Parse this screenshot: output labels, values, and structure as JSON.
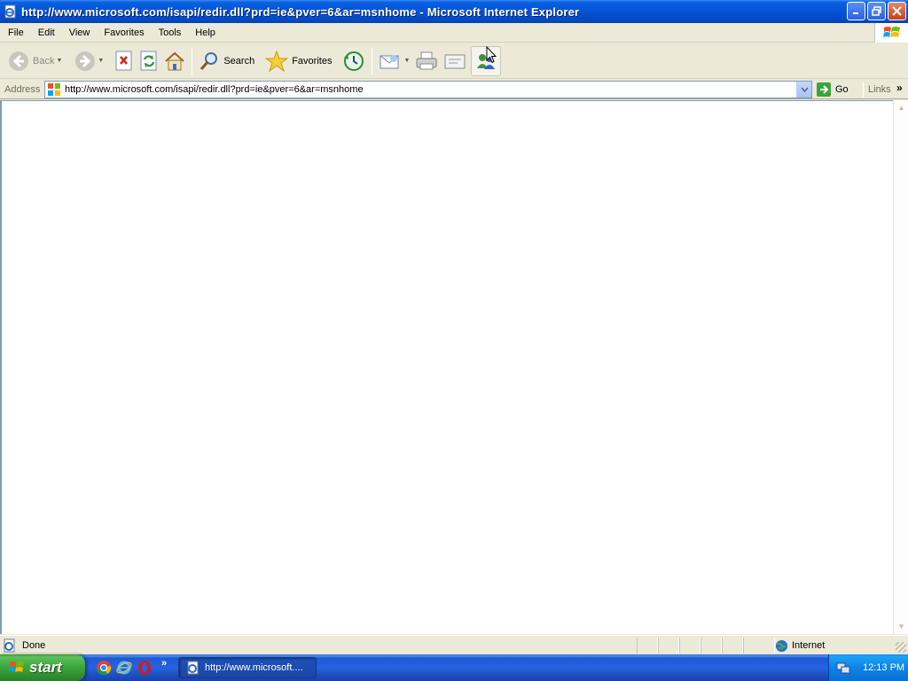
{
  "window": {
    "title": "http://www.microsoft.com/isapi/redir.dll?prd=ie&pver=6&ar=msnhome - Microsoft Internet Explorer"
  },
  "menu": {
    "items": [
      "File",
      "Edit",
      "View",
      "Favorites",
      "Tools",
      "Help"
    ]
  },
  "toolbar": {
    "back_label": "Back",
    "search_label": "Search",
    "favorites_label": "Favorites"
  },
  "address": {
    "label": "Address",
    "url": "http://www.microsoft.com/isapi/redir.dll?prd=ie&pver=6&ar=msnhome",
    "go_label": "Go",
    "links_label": "Links"
  },
  "status": {
    "text": "Done",
    "zone": "Internet"
  },
  "taskbar": {
    "start_label": "start",
    "task_label": "http://www.microsoft....",
    "clock": "12:13 PM"
  },
  "icons": {
    "back": "back-arrow-icon",
    "forward": "forward-arrow-icon",
    "stop": "stop-icon",
    "refresh": "refresh-icon",
    "home": "home-icon",
    "search": "magnifier-icon",
    "favorites": "star-icon",
    "history": "history-icon",
    "mail": "mail-icon",
    "print": "printer-icon",
    "edit": "edit-icon",
    "messenger": "messenger-icon"
  },
  "colors": {
    "titlebar": "#0553d6",
    "chrome": "#ece9d8",
    "taskbar": "#2663e0",
    "start": "#3aa53a"
  }
}
